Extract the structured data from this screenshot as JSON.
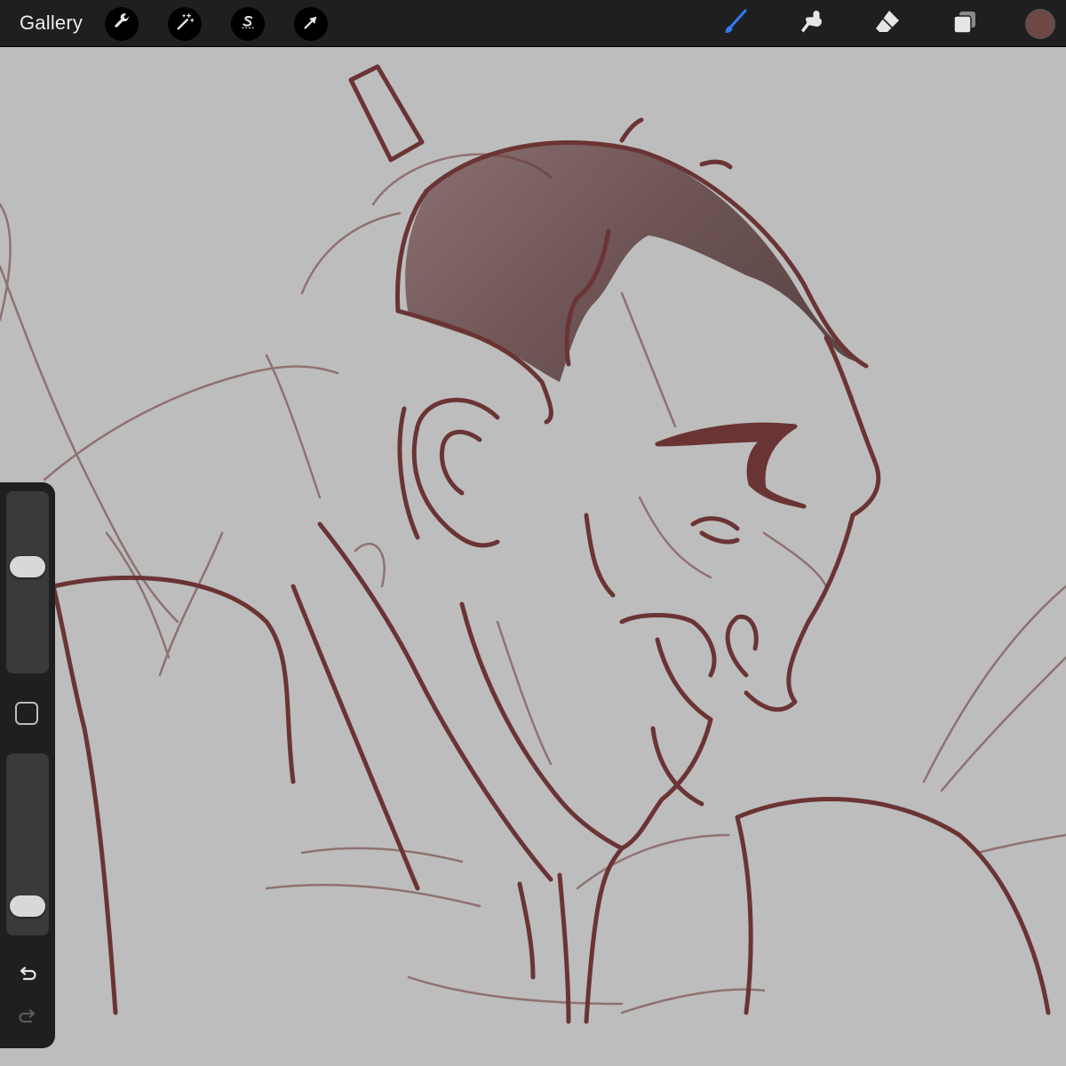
{
  "toolbar": {
    "gallery_label": "Gallery",
    "actions_icon": "wrench-icon",
    "adjustments_icon": "magic-wand-icon",
    "selection_icon": "selection-s-icon",
    "transform_icon": "arrow-cursor-icon",
    "brush_icon": "brush-icon",
    "smudge_icon": "smudge-finger-icon",
    "eraser_icon": "eraser-icon",
    "layers_icon": "layers-icon",
    "active_tool": "brush",
    "active_tool_color": "#2f7cf6",
    "current_color": "#6e4747"
  },
  "sidebar": {
    "brush_size_level": 0.6,
    "opacity_level": 0.1,
    "modifier_icon": "square-modifier-icon",
    "undo_icon": "undo-icon",
    "redo_icon": "redo-icon"
  },
  "canvas": {
    "background_color": "#bdbdbd",
    "line_color": "#6b3434",
    "hair_fill": "#7a5f5f"
  }
}
